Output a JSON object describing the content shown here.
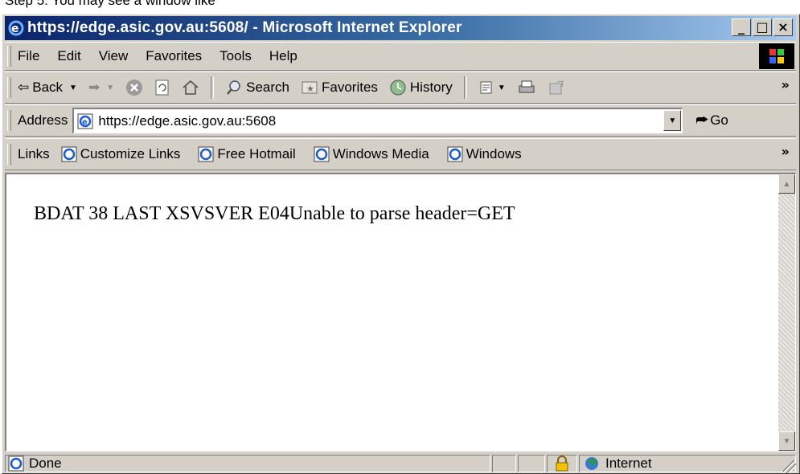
{
  "caption": "Step 5:  You may see a window like",
  "window": {
    "title": "https://edge.asic.gov.au:5608/ - Microsoft Internet Explorer",
    "minimize": "_",
    "maximize": "□",
    "close": "×"
  },
  "menu": {
    "items": [
      {
        "label": "File"
      },
      {
        "label": "Edit"
      },
      {
        "label": "View"
      },
      {
        "label": "Favorites"
      },
      {
        "label": "Tools"
      },
      {
        "label": "Help"
      }
    ]
  },
  "toolbar": {
    "back": "Back",
    "search": "Search",
    "favorites": "Favorites",
    "history": "History",
    "more": "»"
  },
  "address": {
    "label": "Address",
    "value": "https://edge.asic.gov.au:5608",
    "go": "Go"
  },
  "links": {
    "label": "Links",
    "items": [
      {
        "label": "Customize Links"
      },
      {
        "label": "Free Hotmail"
      },
      {
        "label": "Windows Media"
      },
      {
        "label": "Windows"
      }
    ],
    "more": "»"
  },
  "page": {
    "body_text": "BDAT 38 LAST XSVSVER E04Unable to parse header=GET"
  },
  "status": {
    "text": "Done",
    "zone": "Internet"
  },
  "colors": {
    "title_gradient_start": "#0a246a",
    "title_gradient_end": "#a6caf0",
    "chrome": "#d4d0c8"
  }
}
